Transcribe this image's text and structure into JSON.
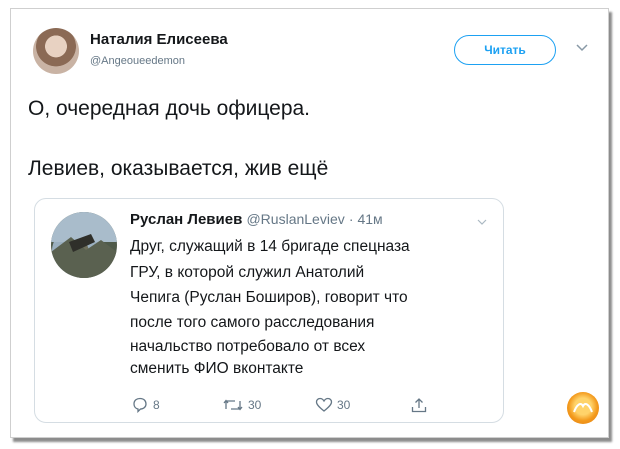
{
  "tweet": {
    "author_name": "Наталия Елисеева",
    "author_handle": "@Angeoueedemon",
    "follow_label": "Читать",
    "text_line1": "О, очередная дочь офицера.",
    "text_line2": "Левиев, оказывается, жив ещё"
  },
  "quoted": {
    "author_name": "Руслан Левиев",
    "author_handle": "@RuslanLeviev",
    "time": "· 41м",
    "lines": [
      "Друг, служащий в 14 бригаде спецназа",
      "ГРУ, в которой служил Анатолий",
      "Чепига (Руслан Боширов), говорит что",
      "после того самого расследования",
      "начальство потребовало от всех",
      "сменить ФИО вконтакте"
    ],
    "reply_count": "8",
    "retweet_count": "30",
    "like_count": "30"
  },
  "icons": [
    "chevron-down-icon",
    "reply-icon",
    "retweet-icon",
    "like-icon",
    "share-icon"
  ],
  "colors": {
    "accent": "#1da1f2",
    "muted": "#657786",
    "text": "#14171a"
  }
}
